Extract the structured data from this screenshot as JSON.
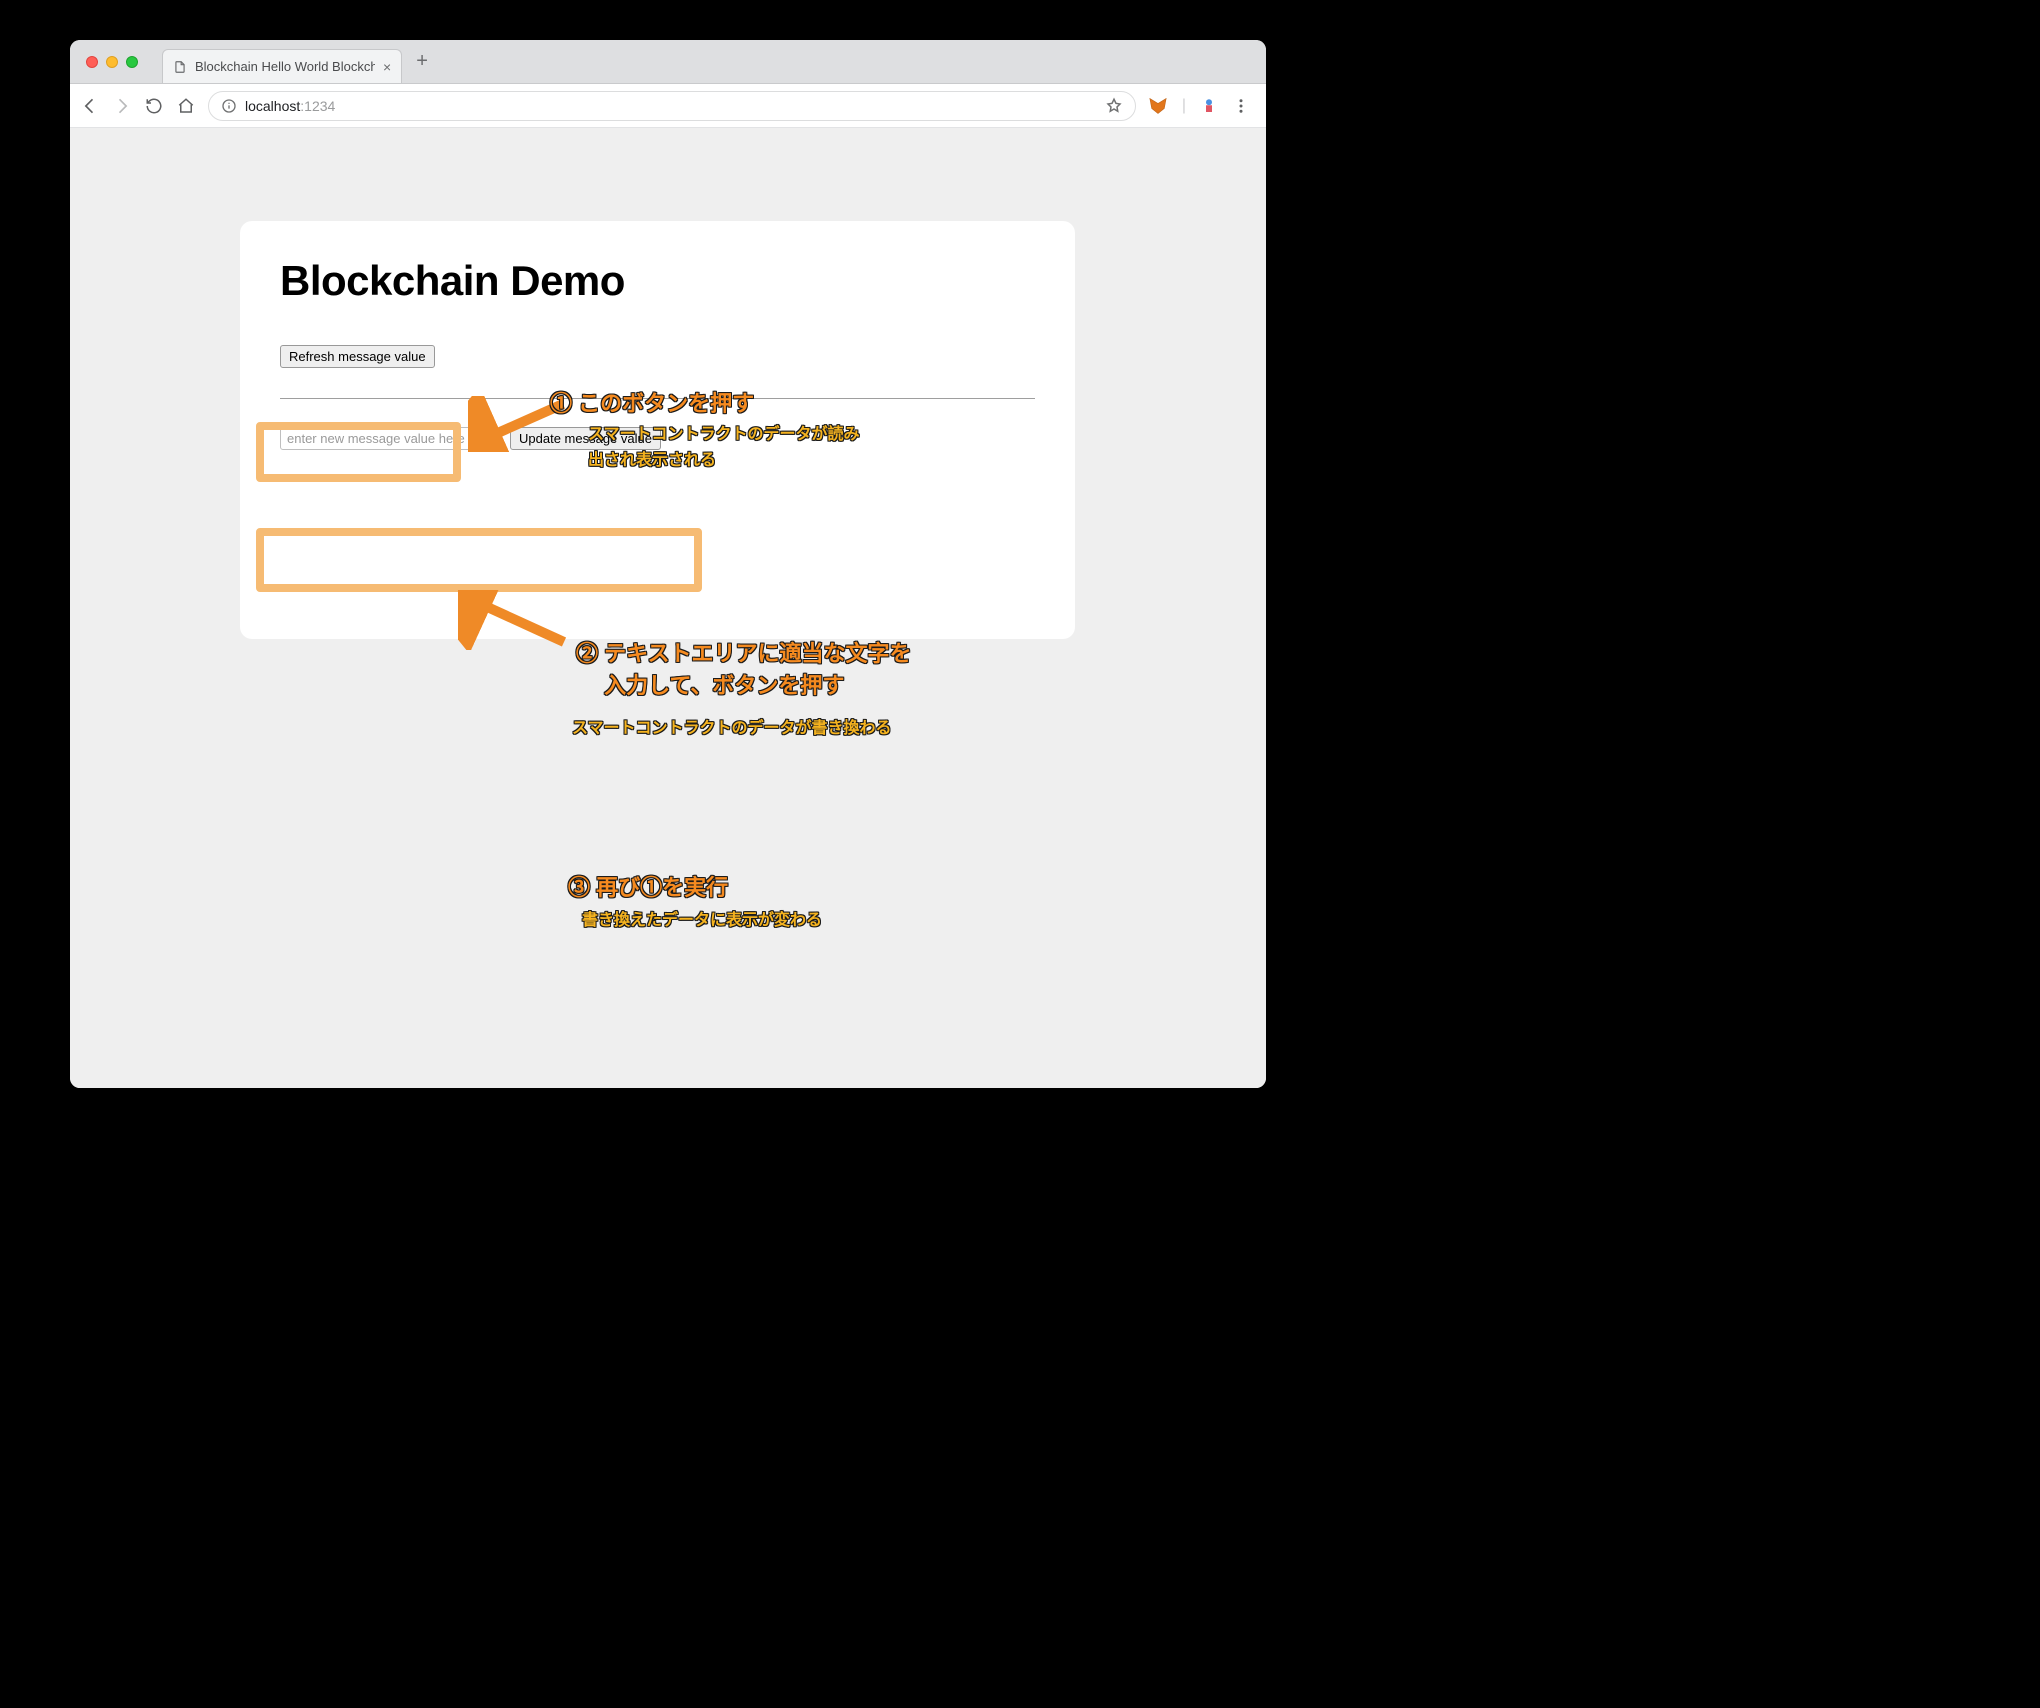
{
  "browser": {
    "tab_title": "Blockchain Hello World Blockch",
    "url_host": "localhost",
    "url_port": ":1234"
  },
  "card": {
    "heading": "Blockchain Demo",
    "refresh_button": "Refresh message value",
    "input_placeholder": "enter new message value here",
    "update_button": "Update message value"
  },
  "annotations": {
    "step1_title": "① このボタンを押す",
    "step1_sub": "スマートコントラクトのデータが読み\n出され表示される",
    "step2_title": "② テキストエリアに適当な文字を\n　 入力して、ボタンを押す",
    "step2_sub": "スマートコントラクトのデータが書き換わる",
    "step3_title": "③ 再び①を実行",
    "step3_sub": "書き換えたデータに表示が変わる"
  }
}
